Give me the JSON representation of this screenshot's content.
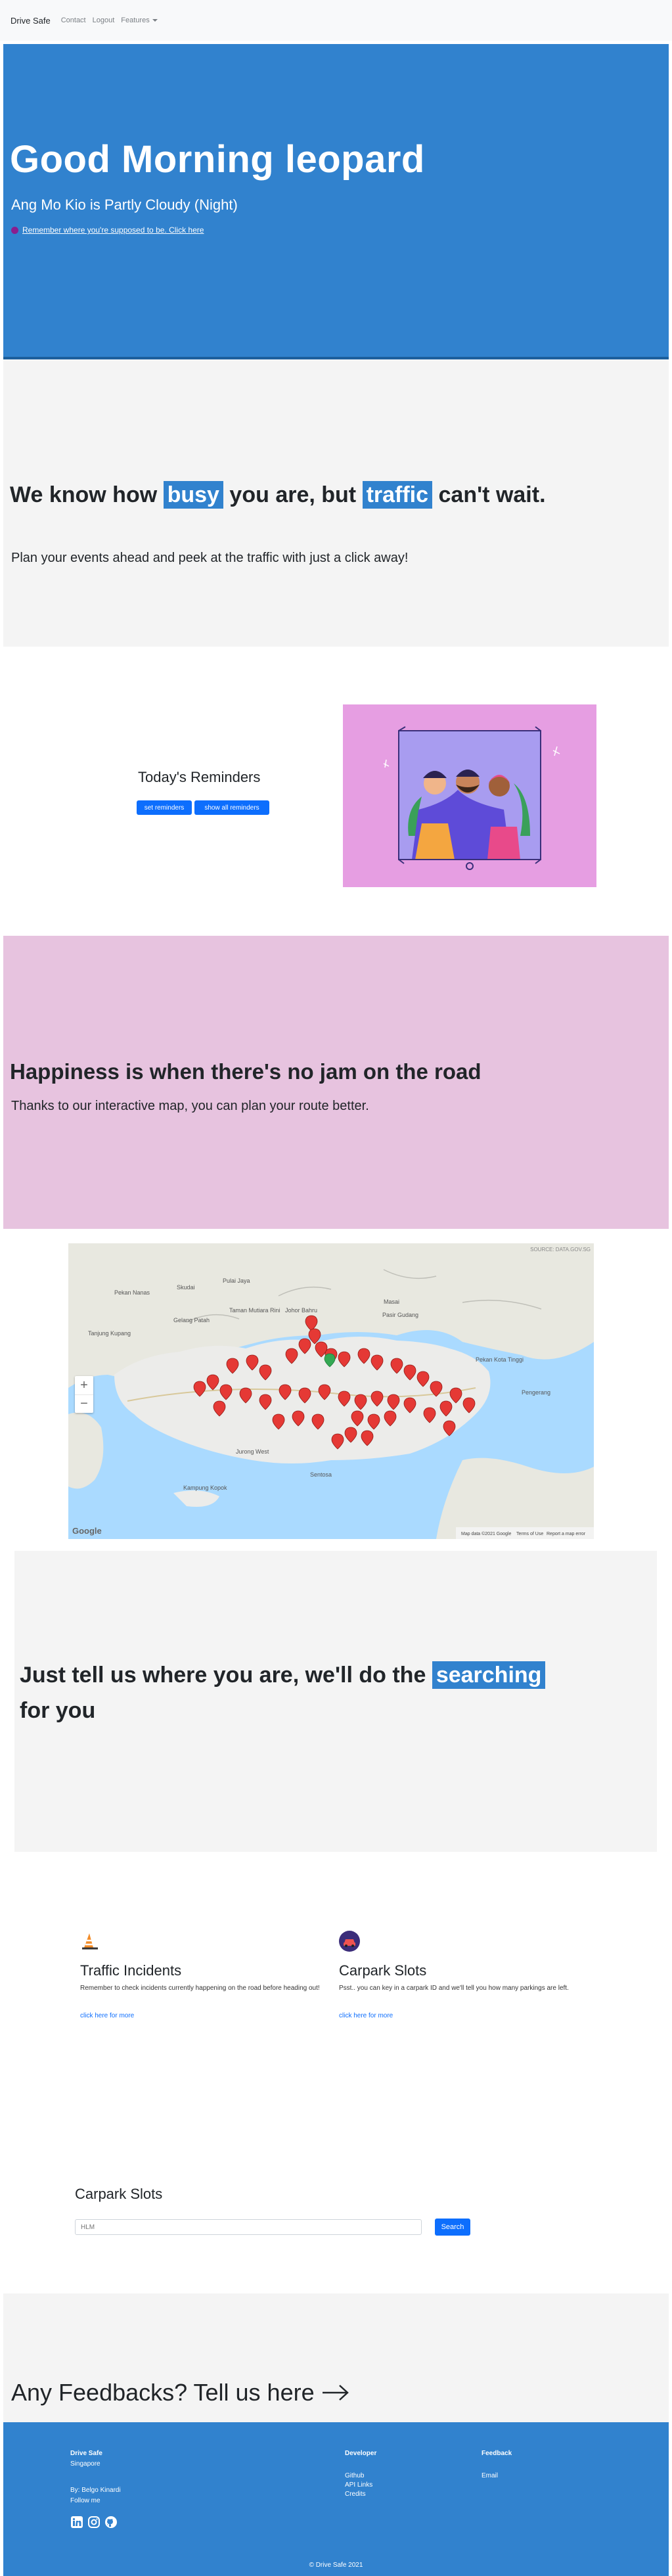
{
  "nav": {
    "brand": "Drive Safe",
    "links": [
      "Contact",
      "Logout",
      "Features"
    ]
  },
  "hero": {
    "greeting": "Good Morning leopard",
    "weather": "Ang Mo Kio is Partly Cloudy (Night)",
    "reminder_link": "Remember where you're supposed to be. Click here"
  },
  "busy": {
    "pre": "We know how",
    "hl1": "busy",
    "mid": "you are, but",
    "hl2": "traffic",
    "post": "can't wait.",
    "desc": "Plan your events ahead and peek at the traffic with just a click away!"
  },
  "reminders": {
    "title": "Today's Reminders",
    "set_button": "set reminders",
    "show_button": "show all reminders"
  },
  "happiness": {
    "title": "Happiness is when there's no jam on the road",
    "desc": "Thanks to our interactive map, you can plan your route better."
  },
  "map": {
    "zoom_in": "+",
    "zoom_out": "−",
    "source": "SOURCE: DATA.GOV.SG",
    "logo": "Google",
    "attribution": "Map data ©2021 Google",
    "terms": "Terms of Use",
    "report": "Report a map error",
    "places": [
      "Skudai",
      "Pulai Jaya",
      "Taman Mutiara Rini",
      "Johor Bahru",
      "Pasir Gudang",
      "Masai",
      "Pengerang",
      "Pekan Nanas",
      "Gelang Patah",
      "Tanjung Kupang",
      "Kampung Kopok",
      "Jurong West",
      "Sentosa",
      "Pekan Kota Tinggi"
    ]
  },
  "searching": {
    "pre": "Just tell us where you are, we'll do the",
    "hl": "searching",
    "post": "for you"
  },
  "features": [
    {
      "icon": "traffic-cone-icon",
      "title": "Traffic Incidents",
      "desc": "Remember to check incidents currently happening on the road before heading out!",
      "link": "click here for more"
    },
    {
      "icon": "car-icon",
      "title": "Carpark Slots",
      "desc": "Psst.. you can key in a carpark ID and we'll tell you how many parkings are left.",
      "link": "click here for more"
    }
  ],
  "carpark": {
    "title": "Carpark Slots",
    "placeholder": "HLM",
    "button": "Search"
  },
  "feedback": {
    "text": "Any Feedbacks? Tell us here"
  },
  "footer": {
    "brand": "Drive Safe",
    "country": "Singapore",
    "by": "By: Belgo Kinardi",
    "follow": "Follow me",
    "dev_heading": "Developer",
    "dev_links": [
      "Github",
      "API Links",
      "Credits"
    ],
    "fb_heading": "Feedback",
    "fb_links": [
      "Email"
    ],
    "copyright": "© Drive Safe 2021"
  },
  "colors": {
    "primary": "#3182ce",
    "button": "#0d6efd",
    "section_grey": "#f4f4f4",
    "section_pink": "#e7c3df",
    "illustration_bg": "#e69ee2"
  }
}
